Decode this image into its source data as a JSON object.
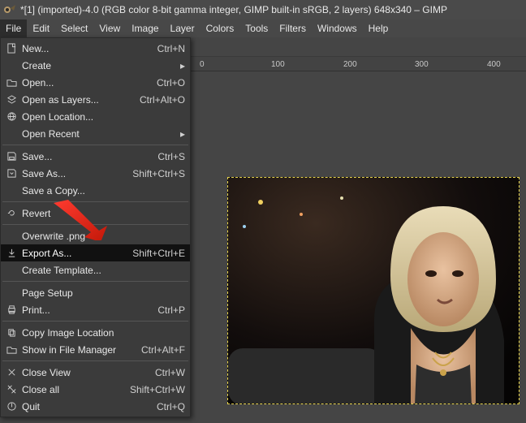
{
  "window": {
    "title": "*[1] (imported)-4.0 (RGB color 8-bit gamma integer, GIMP built-in sRGB, 2 layers) 648x340 – GIMP"
  },
  "menubar": [
    "File",
    "Edit",
    "Select",
    "View",
    "Image",
    "Layer",
    "Colors",
    "Tools",
    "Filters",
    "Windows",
    "Help"
  ],
  "ruler": [
    "0",
    "100",
    "200",
    "300",
    "400"
  ],
  "menu": {
    "groups": [
      [
        {
          "icon": "doc",
          "label": "New...",
          "shortcut": "Ctrl+N"
        },
        {
          "icon": "",
          "label": "Create",
          "submenu": true
        },
        {
          "icon": "open",
          "label": "Open...",
          "shortcut": "Ctrl+O"
        },
        {
          "icon": "layers",
          "label": "Open as Layers...",
          "shortcut": "Ctrl+Alt+O"
        },
        {
          "icon": "globe",
          "label": "Open Location..."
        },
        {
          "icon": "",
          "label": "Open Recent",
          "submenu": true
        }
      ],
      [
        {
          "icon": "save",
          "label": "Save...",
          "shortcut": "Ctrl+S"
        },
        {
          "icon": "saveas",
          "label": "Save As...",
          "shortcut": "Shift+Ctrl+S"
        },
        {
          "icon": "",
          "label": "Save a Copy..."
        }
      ],
      [
        {
          "icon": "revert",
          "label": "Revert"
        }
      ],
      [
        {
          "icon": "",
          "label": "Overwrite .png"
        },
        {
          "icon": "export",
          "label": "Export As...",
          "shortcut": "Shift+Ctrl+E",
          "highlight": true
        },
        {
          "icon": "",
          "label": "Create Template..."
        }
      ],
      [
        {
          "icon": "",
          "label": "Page Setup"
        },
        {
          "icon": "print",
          "label": "Print...",
          "shortcut": "Ctrl+P"
        }
      ],
      [
        {
          "icon": "copy",
          "label": "Copy Image Location"
        },
        {
          "icon": "folder",
          "label": "Show in File Manager",
          "shortcut": "Ctrl+Alt+F"
        }
      ],
      [
        {
          "icon": "close",
          "label": "Close View",
          "shortcut": "Ctrl+W"
        },
        {
          "icon": "closeall",
          "label": "Close all",
          "shortcut": "Shift+Ctrl+W"
        },
        {
          "icon": "quit",
          "label": "Quit",
          "shortcut": "Ctrl+Q"
        }
      ]
    ]
  }
}
